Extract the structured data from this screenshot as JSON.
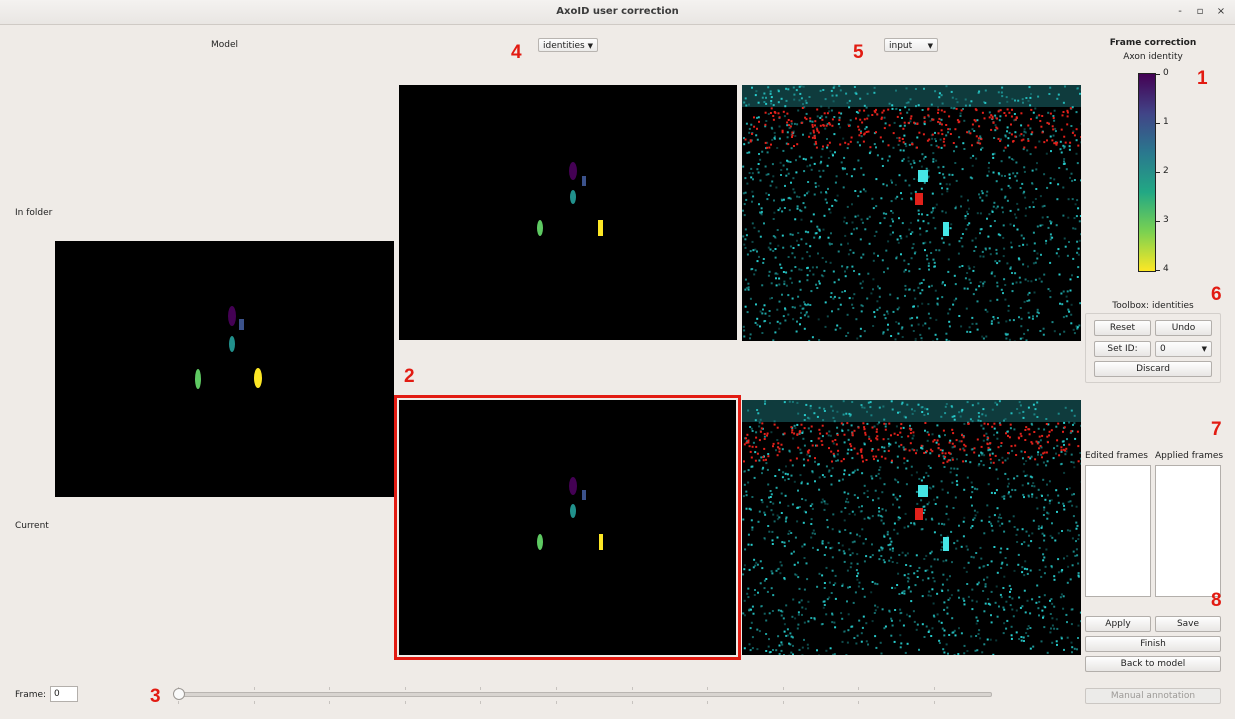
{
  "window": {
    "title": "AxoID user correction",
    "buttons": {
      "minimize": "-",
      "maximize": "▫",
      "close": "×"
    }
  },
  "labels": {
    "model": "Model",
    "in_folder": "In folder",
    "current": "Current",
    "frame": "Frame:"
  },
  "frame_input": {
    "value": "0"
  },
  "dropdowns": {
    "view_mode": "identities",
    "channel": "input"
  },
  "frame_correction": {
    "title": "Frame correction",
    "subtitle": "Axon identity",
    "colorbar_ticks": [
      "0",
      "1",
      "2",
      "3",
      "4"
    ]
  },
  "toolbox": {
    "title": "Toolbox: identities",
    "reset": "Reset",
    "undo": "Undo",
    "set_id": "Set ID:",
    "set_id_value": "0",
    "discard": "Discard"
  },
  "lists": {
    "edited_frames": "Edited frames",
    "applied_frames": "Applied frames"
  },
  "actions": {
    "apply": "Apply",
    "save": "Save",
    "finish": "Finish",
    "back_to_model": "Back to model",
    "manual_annotation": "Manual annotation"
  },
  "slider": {
    "value": 0
  },
  "annotations": [
    "1",
    "2",
    "3",
    "4",
    "5",
    "6",
    "7",
    "8"
  ],
  "colors": {
    "accent": "#e21b12",
    "axon0": "#440154",
    "axon1": "#3b528b",
    "axon2": "#21918c",
    "axon3": "#5ec962",
    "axon4": "#fde725"
  }
}
